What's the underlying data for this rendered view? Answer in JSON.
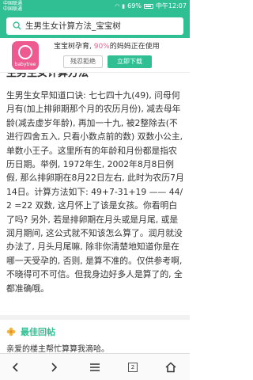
{
  "status_bar": {
    "carrier1": "中国联通",
    "carrier2": "中国联通",
    "battery": "69%",
    "time": "中午12:07"
  },
  "address_bar": {
    "search_text": "生男生女计算方法_宝宝树"
  },
  "app_banner": {
    "logo_text": "babytree",
    "promo_prefix": "宝宝树孕育, ",
    "promo_pct": "90%",
    "promo_suffix": "的妈妈正在使用",
    "later_label": "残忍拒绝",
    "install_label": "立即下载"
  },
  "article": {
    "cut_heading": "生男生女计算方法",
    "body": "生男生女早知道口诀: 七七四十九(49), 问母何月有(加上排卵期那个月的农历月份), 减去母年龄(减去虚岁年龄), 再加一十九, 被2整除去(不进行四舍五入, 只看小数点前的数) 双数小公主, 单数小王子。这里所有的年龄和月份都是指农历日期。举例, 1972年生, 2002年8月8日例假, 那么排卵期在8月22日左右, 此时为农历7月14日。计算方法如下: 49+7-31+19 —— 44/2 =22 双数, 这月怀上了该是女孩。你看明白了吗? 另外, 若是排卵期在月头或是月尾, 或是润月期间, 这公式就不知该怎么算了。润月就没办法了, 月头月尾嘛, 除非你清楚地知道你是在哪一天受孕的, 否则, 是算不准的。仅供参考啊, 不晓得可不可信。但我身边好多人是算了的, 全都准确哦。"
  },
  "best_reply": {
    "title": "最佳回帖",
    "preview": "亲爱的楼主帮忙算算我滴哈。"
  },
  "bottom_bar": {
    "tabs_count": "2"
  },
  "colors": {
    "accent": "#2fbf93",
    "brand_pink": "#ee5a8f"
  }
}
